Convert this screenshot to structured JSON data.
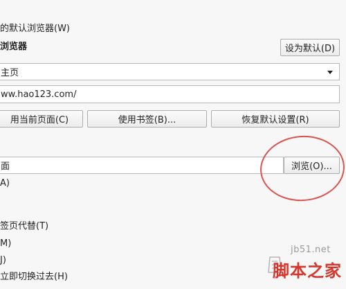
{
  "default_browser": {
    "heading": "的默认浏览器(W)",
    "current_label": "浏览器",
    "set_default_button": "设为默认(D)"
  },
  "homepage": {
    "select_value": "主页",
    "url_value": "ww.hao123.com/",
    "use_current_button": "用当前页面(C)",
    "use_bookmark_button": "使用书签(B)...",
    "restore_default_button": "恢复默认设置(R)"
  },
  "downloads": {
    "folder_value": "面",
    "browse_button": "浏览(O)...",
    "option_a": "A)"
  },
  "tabs": {
    "option_t": "签页代替(T)",
    "option_m": "M)",
    "option_j": "J)",
    "option_h": "立即切换过去(H)"
  },
  "watermark": {
    "url": "jb51.net",
    "brand": "脚本之家"
  },
  "colors": {
    "highlight": "#d9534f",
    "watermark_brand": "#d6362c"
  }
}
